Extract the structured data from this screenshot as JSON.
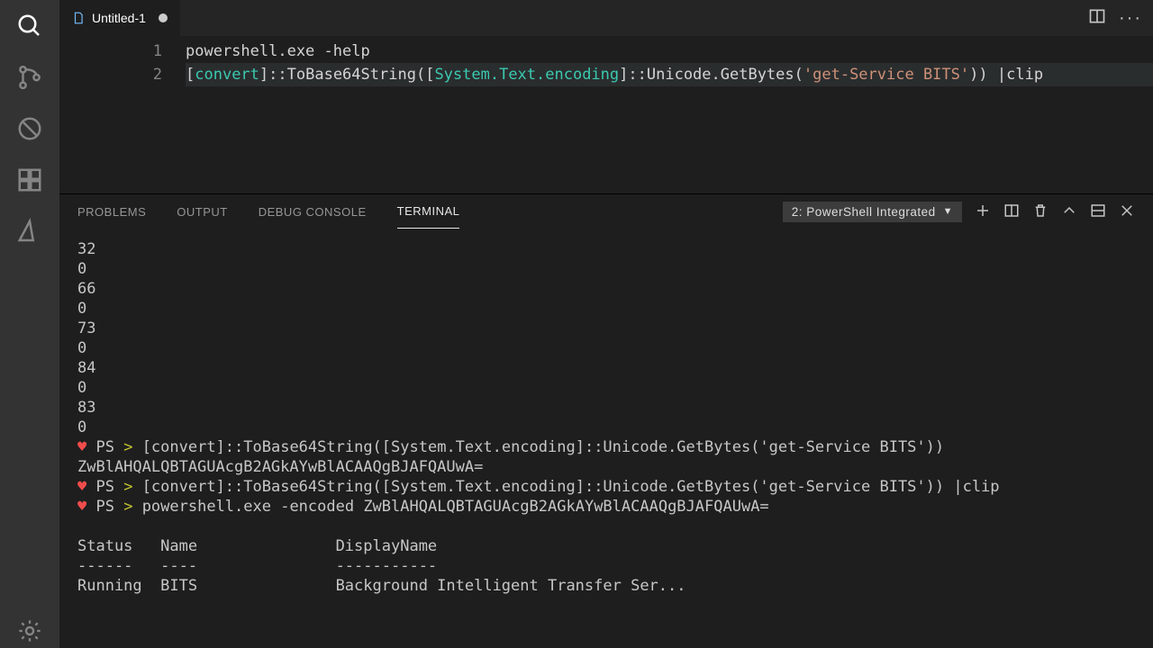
{
  "tab": {
    "title": "Untitled-1"
  },
  "editor": {
    "lineNumbers": [
      "1",
      "2"
    ],
    "line1_cmd": "powershell.exe ",
    "line1_param": "-help",
    "line2_lbr1": "[",
    "line2_convert": "convert",
    "line2_rbr1": "]",
    "line2_sep1": "::",
    "line2_fn1": "ToBase64String",
    "line2_lp": "(",
    "line2_lbr2": "[",
    "line2_enc": "System.Text.encoding",
    "line2_rbr2": "]",
    "line2_sep2": "::",
    "line2_fn2": "Unicode.GetBytes",
    "line2_call": "(",
    "line2_str": "'get-Service BITS'",
    "line2_close": "))",
    "line2_sp": " ",
    "line2_pipe": "|",
    "line2_clip": "clip"
  },
  "panel": {
    "tabs": {
      "problems": "PROBLEMS",
      "output": "OUTPUT",
      "debug": "DEBUG CONSOLE",
      "terminal": "TERMINAL"
    },
    "term_selector": "2: PowerShell Integrated"
  },
  "terminal": {
    "nums": [
      "32",
      "0",
      "66",
      "0",
      "73",
      "0",
      "84",
      "0",
      "83",
      "0"
    ],
    "heart": "♥",
    "ps": " PS ",
    "gt": "> ",
    "cmd1": "[convert]::ToBase64String([System.Text.encoding]::Unicode.GetBytes('get-Service BITS'))",
    "b64": "ZwBlAHQALQBTAGUAcgB2AGkAYwBlACAAQgBJAFQAUwA=",
    "cmd2": "[convert]::ToBase64String([System.Text.encoding]::Unicode.GetBytes('get-Service BITS')) |clip",
    "cmd3": "powershell.exe -encoded ZwBlAHQALQBTAGUAcgB2AGkAYwBlACAAQgBJAFQAUwA=",
    "hdr": "Status   Name               DisplayName",
    "sep": "------   ----               -----------",
    "row": "Running  BITS               Background Intelligent Transfer Ser..."
  }
}
